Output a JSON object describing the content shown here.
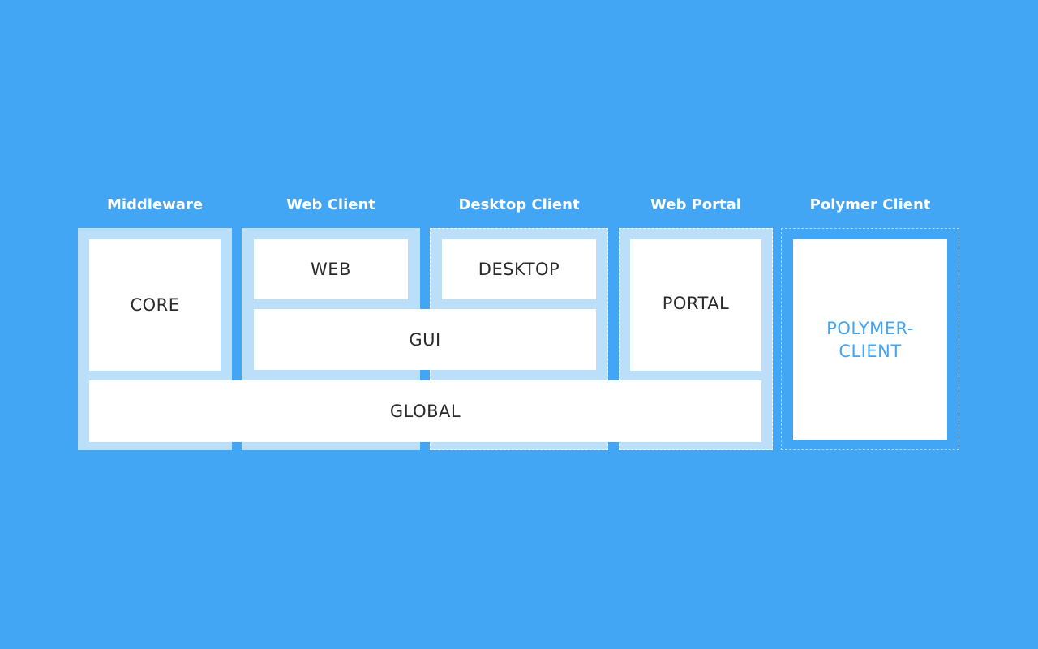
{
  "columns": {
    "middleware": "Middleware",
    "web_client": "Web Client",
    "desktop_client": "Desktop Client",
    "web_portal": "Web Portal",
    "polymer_client": "Polymer Client"
  },
  "modules": {
    "core": "CORE",
    "web": "WEB",
    "desktop": "DESKTOP",
    "gui": "GUI",
    "portal": "PORTAL",
    "global": "GLOBAL",
    "polymer_line1": "POLYMER-",
    "polymer_line2": "CLIENT"
  },
  "colors": {
    "background": "#43a6f5",
    "column_fill": "#bbdff9",
    "module_fill": "#ffffff",
    "polymer_text": "#43a6f5"
  }
}
